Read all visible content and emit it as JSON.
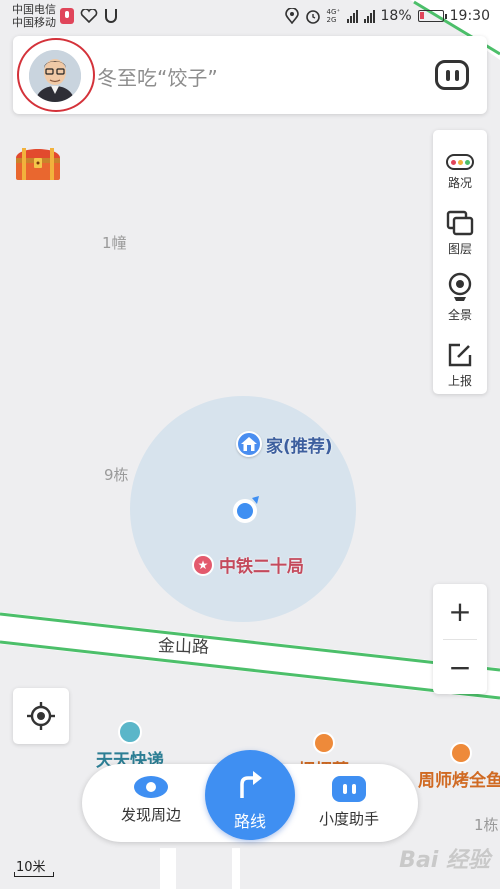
{
  "status_bar": {
    "carrier_1": "中国电信",
    "carrier_2": "中国移动",
    "net_tags": "4G⁺ 2G",
    "battery_percent": "18%",
    "time": "19:30",
    "battery_level": 0.18
  },
  "search": {
    "placeholder": "冬至吃“饺子”",
    "avatar_icon": "user-avatar",
    "voice_icon": "xiaodu-voice-icon"
  },
  "toolbar": {
    "traffic": "路况",
    "layers": "图层",
    "panorama": "全景",
    "report": "上报"
  },
  "map": {
    "labels": {
      "building_1": "1幢",
      "building_9": "9栋",
      "building_1_right": "1栋"
    },
    "road": "金山路",
    "home_poi": "家(推荐)",
    "star_poi": "中铁二十局",
    "poi_express": "天天快递",
    "poi_food": "烟烟蒸",
    "poi_bbq": "周师烤全鱼"
  },
  "zoom": {
    "in": "+",
    "out": "−"
  },
  "bottom_bar": {
    "discover": "发现周边",
    "route": "路线",
    "assistant": "小度助手"
  },
  "scale": "10米",
  "watermark": "Bai 经验",
  "colors": {
    "accent": "#3f8ff2",
    "road_green": "#4cbf6a",
    "avatar_ring": "#d4323a"
  }
}
